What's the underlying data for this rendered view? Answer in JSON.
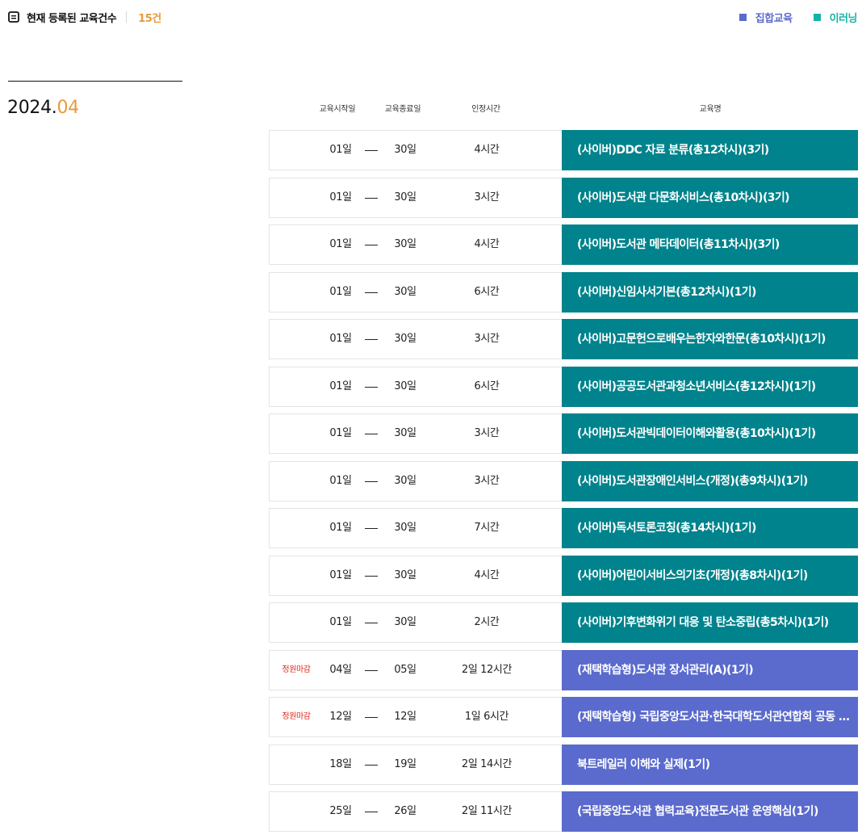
{
  "header": {
    "count_label": "현재 등록된 교육건수",
    "count_value": "15건",
    "icon": "document-icon"
  },
  "legend": [
    {
      "label": "집합교육",
      "color": "#5a6acd"
    },
    {
      "label": "이러닝",
      "color": "#14b3a9"
    }
  ],
  "month": {
    "year": "2024.",
    "month": "04"
  },
  "columns": {
    "start": "교육시작일",
    "end": "교육종료일",
    "hours": "인정시간",
    "title": "교육명"
  },
  "colors": {
    "cyber": "#00838c",
    "group": "#5a6acd",
    "accent": "#e89a3c",
    "closed": "#e0261d"
  },
  "courses": [
    {
      "status": "",
      "start": "01일",
      "end": "30일",
      "hours": "4시간",
      "title": "(사이버)DDC 자료 분류(총12차시)(3기)",
      "type": "cyber"
    },
    {
      "status": "",
      "start": "01일",
      "end": "30일",
      "hours": "3시간",
      "title": "(사이버)도서관 다문화서비스(총10차시)(3기)",
      "type": "cyber"
    },
    {
      "status": "",
      "start": "01일",
      "end": "30일",
      "hours": "4시간",
      "title": "(사이버)도서관 메타데이터(총11차시)(3기)",
      "type": "cyber"
    },
    {
      "status": "",
      "start": "01일",
      "end": "30일",
      "hours": "6시간",
      "title": "(사이버)신임사서기본(총12차시)(1기)",
      "type": "cyber"
    },
    {
      "status": "",
      "start": "01일",
      "end": "30일",
      "hours": "3시간",
      "title": "(사이버)고문헌으로배우는한자와한문(총10차시)(1기)",
      "type": "cyber"
    },
    {
      "status": "",
      "start": "01일",
      "end": "30일",
      "hours": "6시간",
      "title": "(사이버)공공도서관과청소년서비스(총12차시)(1기)",
      "type": "cyber"
    },
    {
      "status": "",
      "start": "01일",
      "end": "30일",
      "hours": "3시간",
      "title": "(사이버)도서관빅데이터이해와활용(총10차시)(1기)",
      "type": "cyber"
    },
    {
      "status": "",
      "start": "01일",
      "end": "30일",
      "hours": "3시간",
      "title": "(사이버)도서관장애인서비스(개정)(총9차시)(1기)",
      "type": "cyber"
    },
    {
      "status": "",
      "start": "01일",
      "end": "30일",
      "hours": "7시간",
      "title": "(사이버)독서토론코칭(총14차시)(1기)",
      "type": "cyber"
    },
    {
      "status": "",
      "start": "01일",
      "end": "30일",
      "hours": "4시간",
      "title": "(사이버)어린이서비스의기초(개정)(총8차시)(1기)",
      "type": "cyber"
    },
    {
      "status": "",
      "start": "01일",
      "end": "30일",
      "hours": "2시간",
      "title": "(사이버)기후변화위기 대응 및 탄소중립(총5차시)(1기)",
      "type": "cyber"
    },
    {
      "status": "정원마감",
      "start": "04일",
      "end": "05일",
      "hours": "2일 12시간",
      "title": "(재택학습형)도서관 장서관리(A)(1기)",
      "type": "group"
    },
    {
      "status": "정원마감",
      "start": "12일",
      "end": "12일",
      "hours": "1일 6시간",
      "title": "(재택학습형) 국립중앙도서관·한국대학도서관연합회 공동 교육",
      "type": "group"
    },
    {
      "status": "",
      "start": "18일",
      "end": "19일",
      "hours": "2일 14시간",
      "title": "북트레일러 이해와 실제(1기)",
      "type": "group"
    },
    {
      "status": "",
      "start": "25일",
      "end": "26일",
      "hours": "2일 11시간",
      "title": "(국립중앙도서관 협력교육)전문도서관 운영핵심(1기)",
      "type": "group"
    }
  ]
}
